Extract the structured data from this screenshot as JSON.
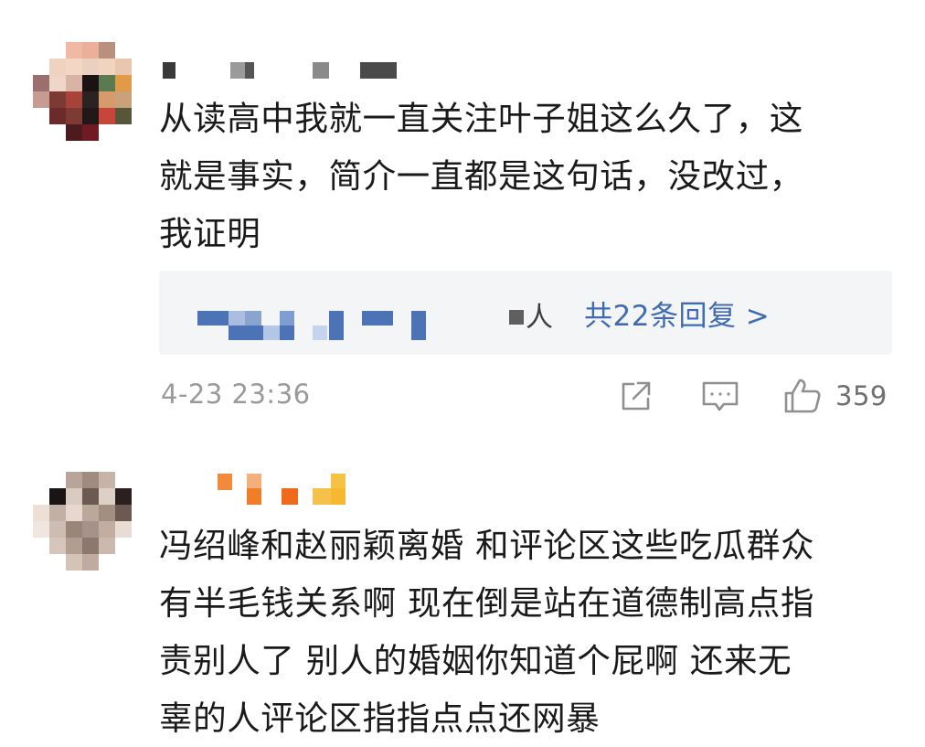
{
  "comments": [
    {
      "text_lines": [
        "从读高中我就一直关注叶子姐这么久了，这",
        "就是事实，简介一直都是这句话，没改过，",
        "我证明"
      ],
      "reply_summary": {
        "person_suffix": "人",
        "link_text": "共22条回复 >"
      },
      "timestamp": "4-23 23:36",
      "like_count": "359"
    },
    {
      "text_lines": [
        "冯绍峰和赵丽颖离婚 和评论区这些吃瓜群众",
        "有半毛钱关系啊 现在倒是站在道德制高点指",
        "责别人了 别人的婚姻你知道个屁啊 还来无",
        "辜的人评论区指指点点还网暴"
      ]
    }
  ],
  "icons": {
    "share": "share-icon",
    "comment": "comment-icon",
    "like": "thumbs-up-icon"
  },
  "colors": {
    "link": "#3f6bb5",
    "meta_text": "#9a9a9a",
    "reply_bg": "#f4f5f7"
  }
}
